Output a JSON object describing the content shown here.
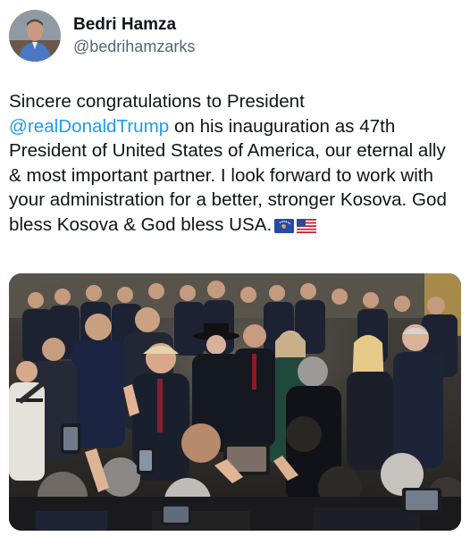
{
  "user": {
    "display_name": "Bedri Hamza",
    "handle": "@bedrihamzarks",
    "avatar_icon": "avatar-photo"
  },
  "tweet": {
    "text_before": "Sincere congratulations to President ",
    "mention": "@realDonaldTrump",
    "text_after": " on his inauguration as 47th President of United States of America, our eternal ally & most important partner. I look forward to work with your administration for a better, stronger Kosova. God bless Kosova & God bless USA.",
    "flags": [
      "kosovo-flag-icon",
      "usa-flag-icon"
    ]
  },
  "media": {
    "type": "photo",
    "subject": "inauguration-crowd-photo"
  },
  "colors": {
    "mention": "#1d9bf0",
    "handle": "#536471",
    "text": "#0f1419"
  }
}
